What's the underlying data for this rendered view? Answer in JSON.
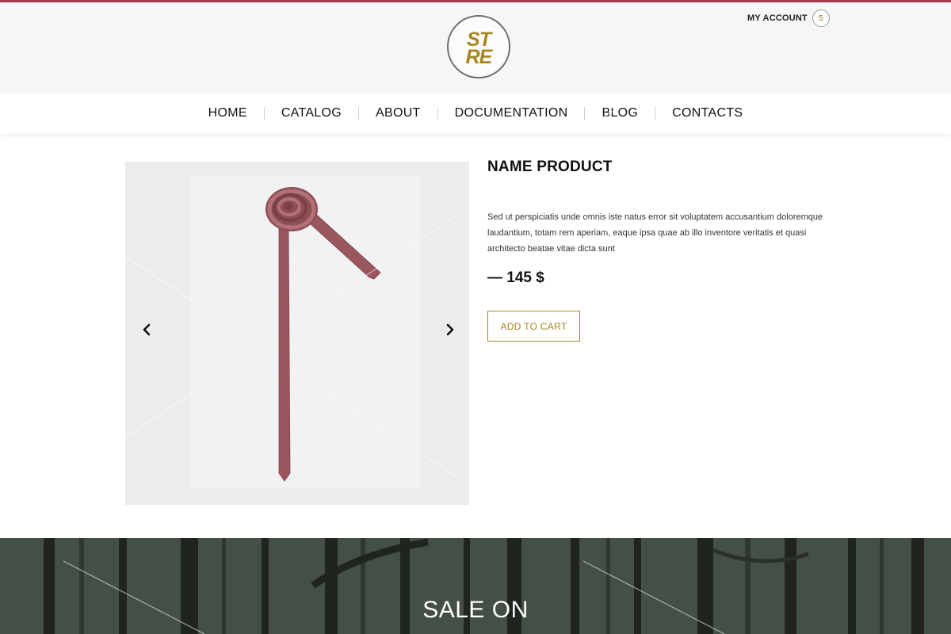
{
  "header": {
    "logo": {
      "line1": "ST",
      "line2": "RE"
    },
    "account": {
      "label": "MY ACCOUNT",
      "count": "5"
    }
  },
  "nav": {
    "items": [
      {
        "label": "HOME"
      },
      {
        "label": "CATALOG"
      },
      {
        "label": "ABOUT"
      },
      {
        "label": "DOCUMENTATION"
      },
      {
        "label": "BLOG"
      },
      {
        "label": "CONTACTS"
      }
    ]
  },
  "gallery": {
    "prev_icon": "chevron-left-icon",
    "next_icon": "chevron-right-icon",
    "image": "necktie"
  },
  "product": {
    "title": "NAME PRODUCT",
    "description": "Sed ut perspiciatis unde omnis iste natus error sit voluptatem accusantium doloremque laudantium, totam rem aperiam, eaque ipsa quae ab illo inventore veritatis et quasi architecto beatae vitae dicta sunt",
    "price": "— 145 $",
    "add_to_cart_label": "ADD TO CART"
  },
  "sale": {
    "title": "SALE ON"
  },
  "colors": {
    "accent_gold": "#a6861f",
    "top_bar": "#a23a4b",
    "header_bg": "#f6f6f6",
    "gallery_bg": "#ececec",
    "tie": "#9e5a62",
    "forest": "#313a31"
  }
}
